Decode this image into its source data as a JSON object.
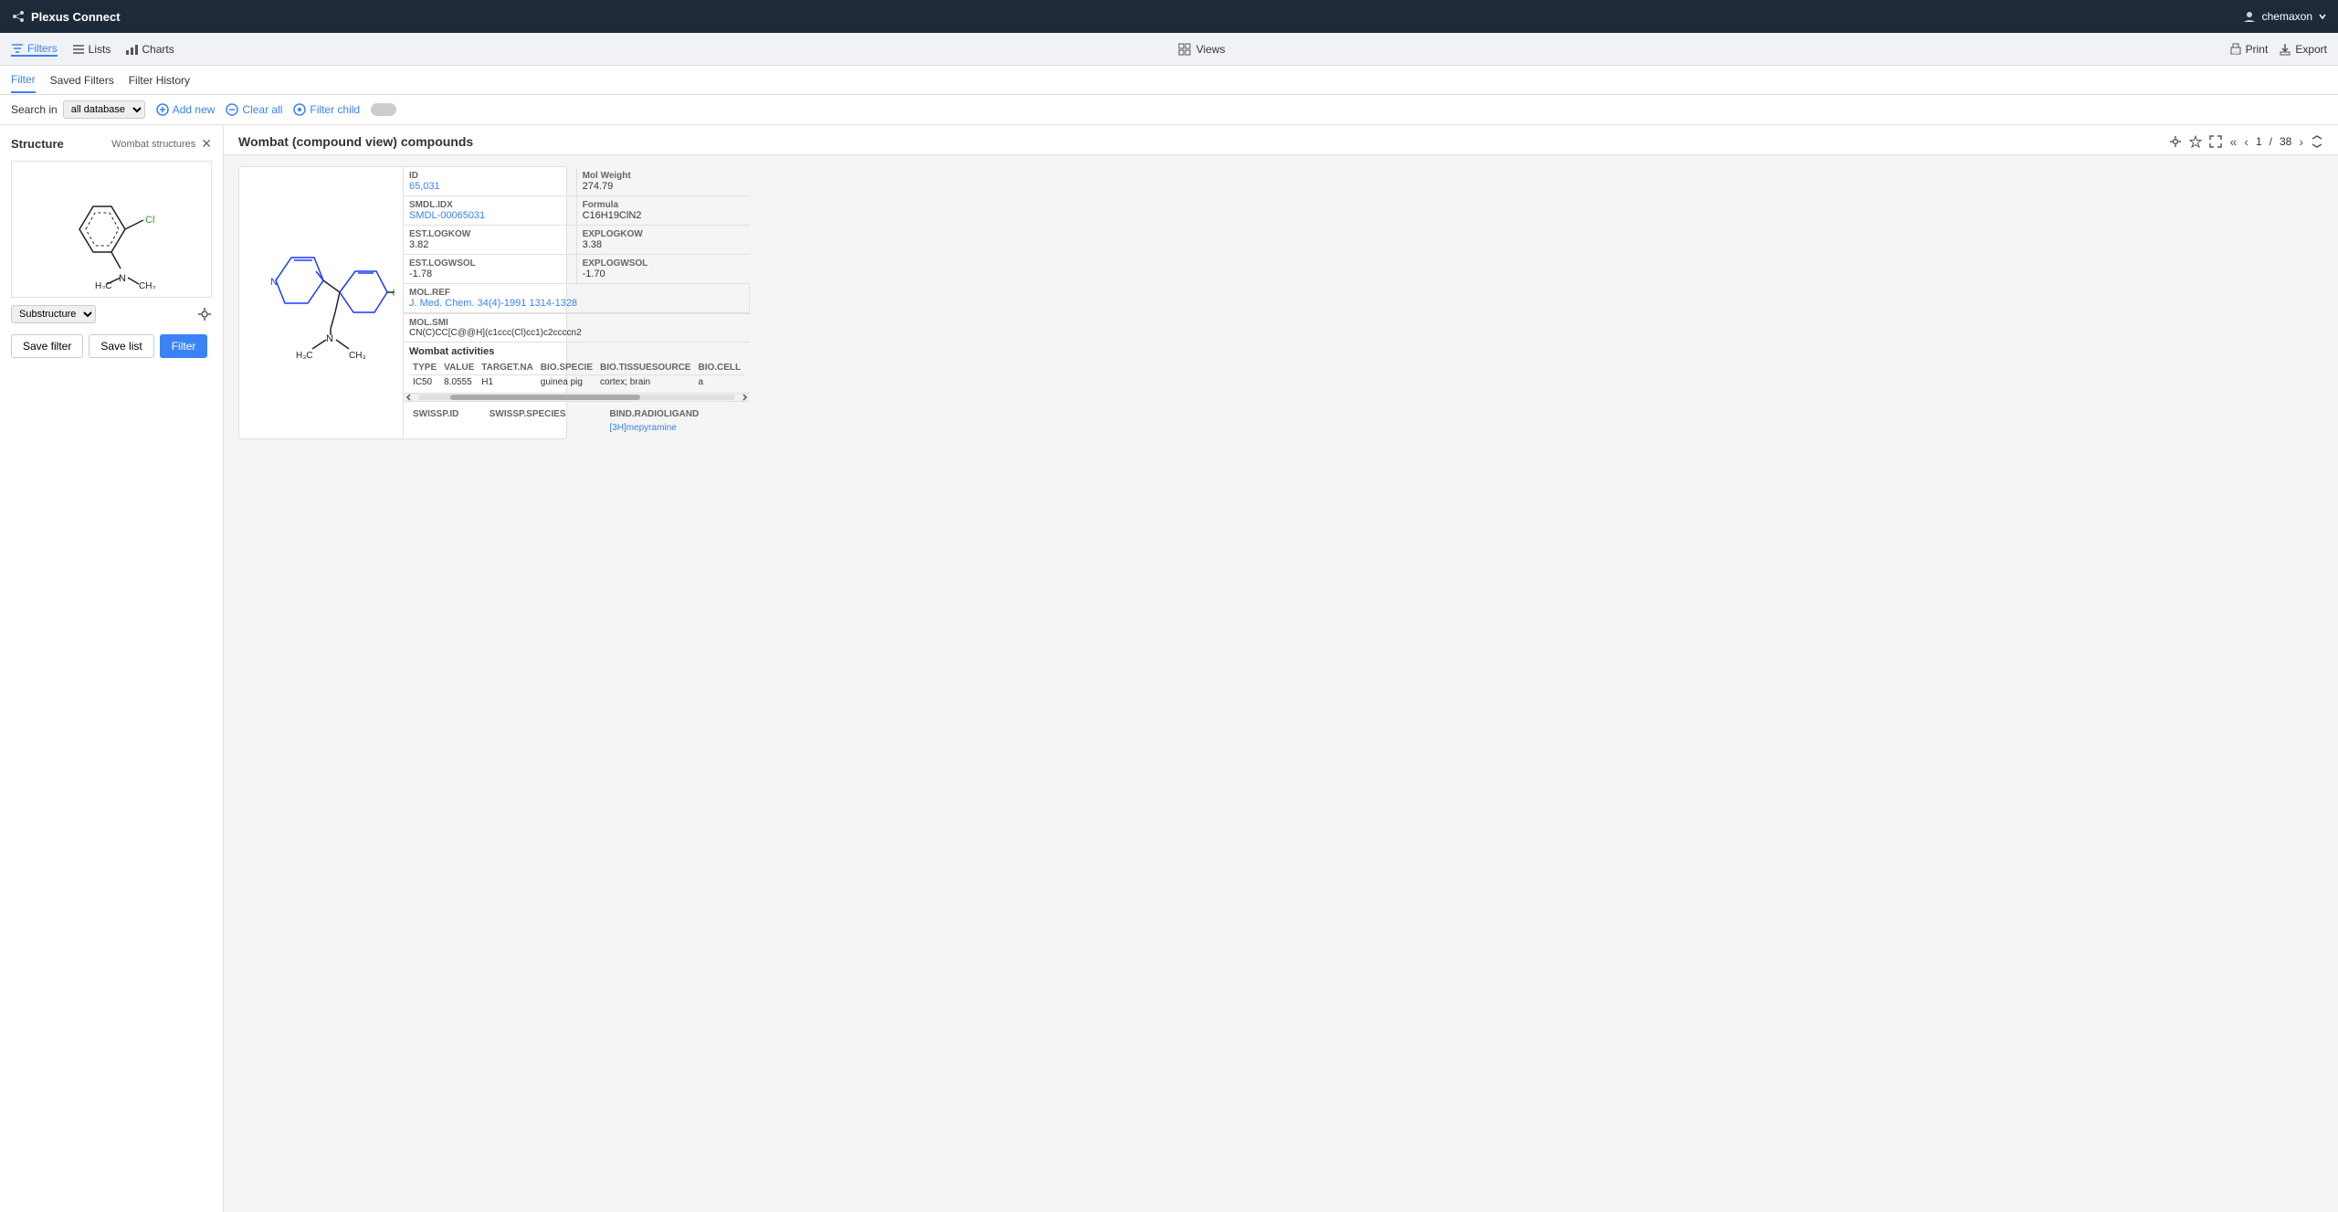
{
  "app": {
    "name": "Plexus Connect",
    "user": "chemaxon"
  },
  "header": {
    "toolbar": {
      "filters_label": "Filters",
      "lists_label": "Lists",
      "charts_label": "Charts",
      "views_label": "Views",
      "print_label": "Print",
      "export_label": "Export"
    }
  },
  "sub_tabs": {
    "filter": "Filter",
    "saved_filters": "Saved Filters",
    "filter_history": "Filter History"
  },
  "filter_bar": {
    "search_label": "Search in",
    "database_option": "all database",
    "add_new": "Add new",
    "clear_all": "Clear all",
    "filter_child": "Filter child"
  },
  "filter_panel": {
    "title": "Structure",
    "subtitle": "Wombat structures",
    "substructure_label": "Substructure"
  },
  "content": {
    "title": "Wombat (compound view) compounds",
    "page_current": "1",
    "page_total": "38"
  },
  "compound": {
    "id_label": "ID",
    "id_value": "65,031",
    "mol_weight_label": "Mol Weight",
    "mol_weight_value": "274.79",
    "smdl_idx_label": "SMDL.IDX",
    "smdl_idx_value": "SMDL-00065031",
    "formula_label": "Formula",
    "formula_value": "C16H19ClN2",
    "est_logkow_label": "EST.LOGKOW",
    "est_logkow_value": "3.82",
    "exp_logkow_label": "EXPLOGKOW",
    "exp_logkow_value": "3.38",
    "est_logwsol_label": "EST.LOGWSOL",
    "est_logwsol_value": "-1.78",
    "exp_logwsol_label": "EXPLOGWSOL",
    "exp_logwsol_value": "-1.70",
    "mol_ref_label": "MOL.REF",
    "mol_ref_value": "J. Med. Chem. 34(4)-1991 1314-1328",
    "mol_smi_label": "MOL.SMI",
    "mol_smi_value": "CN(C)CC[C@@H](c1ccc(Cl)cc1)c2ccccn2",
    "activities_title": "Wombat activities",
    "activities_columns": [
      "TYPE",
      "VALUE",
      "TARGET.NA",
      "BIO.SPECIE",
      "BIO.TISSUESOURCE",
      "BIO.CELL"
    ],
    "activities_rows": [
      {
        "type": "IC50",
        "value": "8.0555",
        "target": "H1",
        "species": "guinea pig",
        "tissue": "cortex; brain",
        "cell": "a"
      }
    ],
    "swissp_columns": [
      "SWISSP.ID",
      "SWISSP.SPECIES",
      "BIND.RADIOLIGAND"
    ],
    "swissp_rows": [
      {
        "id": "",
        "species": "",
        "radioligand": "[3H]mepyramine"
      }
    ]
  }
}
